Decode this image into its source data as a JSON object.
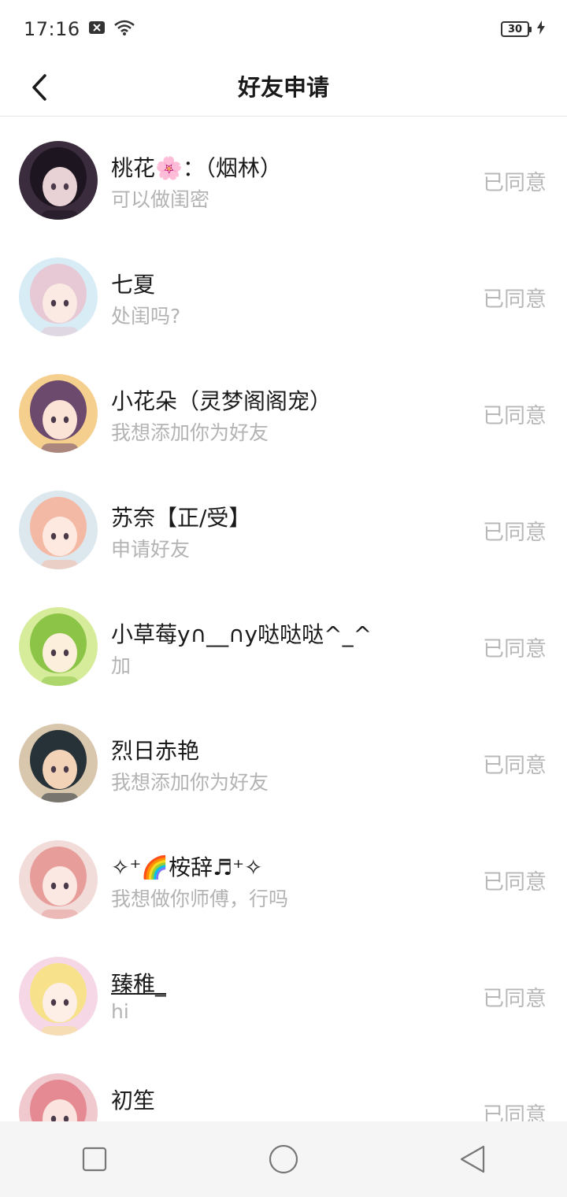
{
  "status_bar": {
    "time": "17:16",
    "battery": "30"
  },
  "header": {
    "title": "好友申请"
  },
  "requests": [
    {
      "name": "桃花🌸：（烟林）",
      "message": "可以做闺密",
      "status": "已同意",
      "avatar_bg": "#3a2c3c",
      "avatar_hair": "#1d1620",
      "avatar_face": "#e8d2d6"
    },
    {
      "name": "七夏",
      "message": "处闺吗?",
      "status": "已同意",
      "avatar_bg": "#d8ecf6",
      "avatar_hair": "#e6c9d4",
      "avatar_face": "#fbe9e4"
    },
    {
      "name": "小花朵（灵梦阁阁宠）",
      "message": "我想添加你为好友",
      "status": "已同意",
      "avatar_bg": "#f5cf8e",
      "avatar_hair": "#6b4a6d",
      "avatar_face": "#fbe3d6"
    },
    {
      "name": "苏奈【正/受】",
      "message": "申请好友",
      "status": "已同意",
      "avatar_bg": "#dde8ee",
      "avatar_hair": "#f4b9a5",
      "avatar_face": "#fde9df"
    },
    {
      "name": "小草莓y∩__∩y哒哒哒^_^",
      "message": "加",
      "status": "已同意",
      "avatar_bg": "#d6ec9a",
      "avatar_hair": "#8cc447",
      "avatar_face": "#fcefdc"
    },
    {
      "name": "烈日赤艳",
      "message": "我想添加你为好友",
      "status": "已同意",
      "avatar_bg": "#d9c7ad",
      "avatar_hair": "#263138",
      "avatar_face": "#f2d3b8"
    },
    {
      "name": "✧⁺🌈桉辞♬⁺✧",
      "message": "我想做你师傅，行吗",
      "status": "已同意",
      "avatar_bg": "#f1dcd9",
      "avatar_hair": "#e79d9a",
      "avatar_face": "#fbe8e2"
    },
    {
      "name": "臻稚_",
      "message": "hi",
      "status": "已同意",
      "avatar_bg": "#f6d7e6",
      "avatar_hair": "#f7e28b",
      "avatar_face": "#fdeee6"
    },
    {
      "name": "初笙",
      "message": "",
      "status": "已同意",
      "avatar_bg": "#f0c9cf",
      "avatar_hair": "#e58a93",
      "avatar_face": "#fbe4df"
    }
  ],
  "nav": {
    "recents_icon": "square-icon",
    "home_icon": "circle-icon",
    "back_icon": "triangle-back-icon"
  }
}
